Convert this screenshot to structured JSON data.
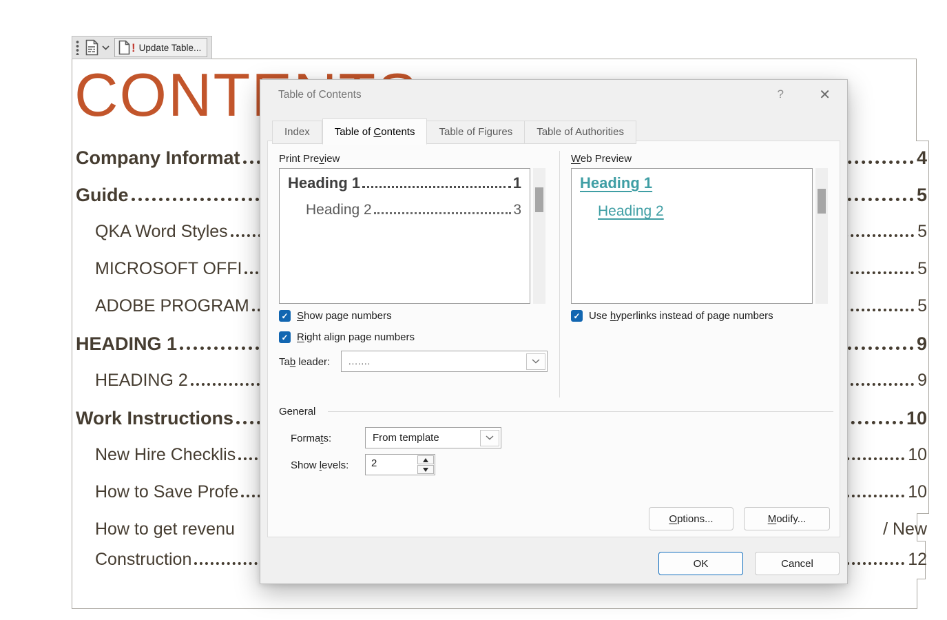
{
  "colors": {
    "doc_title_orange": "#C2552B",
    "doc_text": "#463D31",
    "checkbox_blue": "#1266B1",
    "hyperlink_teal": "#3F9EA4",
    "ok_button_border": "#0F6CBD"
  },
  "toolbar": {
    "update_table_label": "Update Table...",
    "icons": [
      "grip-dots",
      "toc-document-icon",
      "chevron-down-icon",
      "document-alert-icon"
    ]
  },
  "document": {
    "title": "CONTENTS",
    "entries": [
      {
        "label": "Company Informat",
        "level": 1,
        "right": "4",
        "leader": true,
        "cont": false
      },
      {
        "label": "Guide",
        "level": 1,
        "right": "5",
        "leader": true,
        "cont": false
      },
      {
        "label": "QKA Word Styles",
        "level": 2,
        "right": "5",
        "leader": true,
        "cont": false
      },
      {
        "label": "MICROSOFT OFFI",
        "level": 2,
        "right": "5",
        "leader": true,
        "cont": false
      },
      {
        "label": "ADOBE PROGRAM",
        "level": 2,
        "right": "5",
        "leader": true,
        "cont": false
      },
      {
        "label": "HEADING 1",
        "level": 1,
        "right": "9",
        "leader": true,
        "cont": false
      },
      {
        "label": "HEADING 2",
        "level": 2,
        "right": "9",
        "leader": true,
        "cont": false
      },
      {
        "label": "Work Instructions",
        "level": 1,
        "right": "10",
        "leader": true,
        "cont": false
      },
      {
        "label": "New Hire Checklis",
        "level": 2,
        "right": "10",
        "leader": true,
        "cont": false
      },
      {
        "label": "How to Save Profe",
        "level": 2,
        "right": "10",
        "leader": true,
        "cont": false
      },
      {
        "label": "How to get revenu",
        "level": 2,
        "right": "/ New",
        "leader": false,
        "cont": false
      },
      {
        "label": "Construction",
        "level": 2,
        "right": "12",
        "leader": true,
        "cont": true
      }
    ]
  },
  "dialog": {
    "title": "Table of Contents",
    "help_glyph": "?",
    "close_glyph": "✕",
    "tabs": [
      {
        "pre": "Index",
        "key": "",
        "post": "",
        "active": false
      },
      {
        "pre": "Table of ",
        "key": "C",
        "post": "ontents",
        "active": true
      },
      {
        "pre": "Table of Figures",
        "key": "",
        "post": "",
        "active": false
      },
      {
        "pre": "Table of Authorities",
        "key": "",
        "post": "",
        "active": false
      }
    ],
    "print_preview": {
      "label": {
        "pre": "Print Pre",
        "key": "v",
        "post": "iew"
      },
      "entries": [
        {
          "text": "Heading 1",
          "page": "1"
        },
        {
          "text": "Heading 2",
          "page": "3"
        }
      ]
    },
    "web_preview": {
      "label": {
        "pre": "",
        "key": "W",
        "post": "eb Preview"
      },
      "links": [
        {
          "text": "Heading 1"
        },
        {
          "text": "Heading 2"
        }
      ]
    },
    "checkboxes": {
      "show_page_numbers": {
        "pre": "",
        "key": "S",
        "post": "how page numbers",
        "checked": true
      },
      "right_align": {
        "pre": "",
        "key": "R",
        "post": "ight align page numbers",
        "checked": true
      },
      "use_hyperlinks": {
        "pre": "Use ",
        "key": "h",
        "post": "yperlinks instead of page numbers",
        "checked": true
      }
    },
    "tab_leader": {
      "label": {
        "pre": "Ta",
        "key": "b",
        "post": " leader:"
      },
      "value": "......."
    },
    "general": {
      "label": "General",
      "formats": {
        "label": {
          "pre": "Forma",
          "key": "t",
          "post": "s:"
        },
        "value": "From template"
      },
      "show_levels": {
        "label": {
          "pre": "Show ",
          "key": "l",
          "post": "evels:"
        },
        "value": "2"
      }
    },
    "buttons": {
      "options": {
        "pre": "",
        "key": "O",
        "post": "ptions..."
      },
      "modify": {
        "pre": "",
        "key": "M",
        "post": "odify..."
      },
      "ok": "OK",
      "cancel": "Cancel"
    },
    "check_glyph": "✓"
  }
}
